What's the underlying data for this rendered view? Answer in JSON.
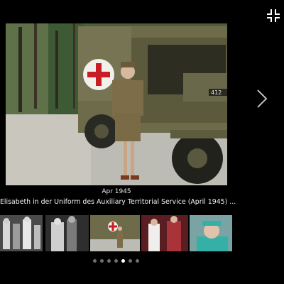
{
  "viewer": {
    "caption": {
      "date": "Apr 1945",
      "title": "Elisabeth in der Uniform des Auxiliary Territorial Service (April 1945) ..."
    },
    "thumbnails": [
      {
        "subject": "black-and-white family group photo"
      },
      {
        "subject": "black-and-white portrait photo"
      },
      {
        "subject": "color photo of woman in uniform beside ambulance",
        "selected": true
      },
      {
        "subject": "color photo of ceremonial scene"
      },
      {
        "subject": "color portrait of elderly queen in turquoise"
      }
    ],
    "pagination": {
      "total": 7,
      "current": 5
    },
    "icons": {
      "fullscreen": "fullscreen-exit-icon",
      "next": "chevron-right-icon"
    },
    "colors": {
      "background": "#000000",
      "dot_inactive": "#6e6e6e",
      "dot_active": "#ffffff"
    }
  }
}
